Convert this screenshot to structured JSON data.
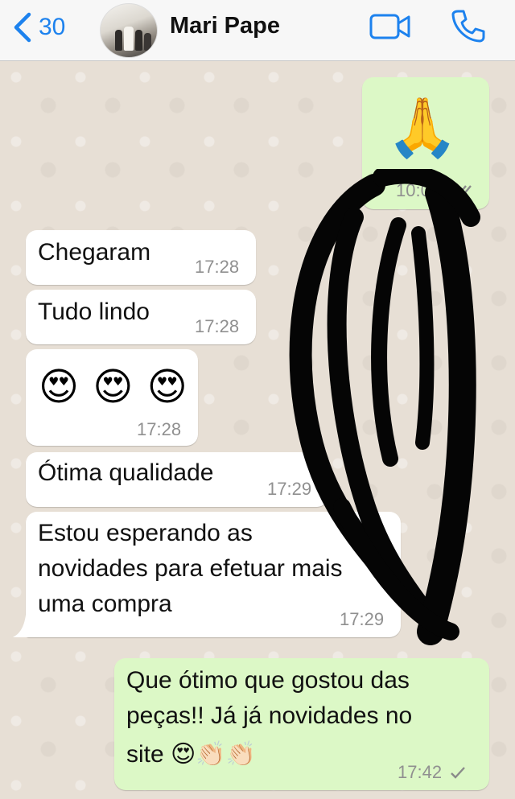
{
  "header": {
    "back_count": "30",
    "contact_name": "Mari Pape",
    "back_icon": "chevron-left-icon",
    "video_icon": "video-call-icon",
    "call_icon": "phone-icon"
  },
  "colors": {
    "accent": "#1d82ee",
    "incoming_bubble": "#ffffff",
    "outgoing_bubble": "#dcf8c6",
    "read_ticks": "#8a8a8a"
  },
  "messages": [
    {
      "direction": "out",
      "emoji": "🙏",
      "time": "10:08",
      "status": "double-check"
    },
    {
      "direction": "in",
      "text": "Chegaram",
      "time": "17:28"
    },
    {
      "direction": "in",
      "text": "Tudo lindo",
      "time": "17:28"
    },
    {
      "direction": "in",
      "emoji": "😍 😍 😍",
      "time": "17:28"
    },
    {
      "direction": "in",
      "text": "Ótima qualidade",
      "time": "17:29"
    },
    {
      "direction": "in",
      "lines": [
        "Estou esperando as",
        "novidades para efetuar mais",
        "uma compra"
      ],
      "time": "17:29"
    },
    {
      "direction": "out",
      "lines": [
        "Que ótimo que gostou das",
        "peças!! Já já novidades no",
        "site 😍👏🏻👏🏻"
      ],
      "time": "17:42",
      "status": "single-check"
    }
  ]
}
